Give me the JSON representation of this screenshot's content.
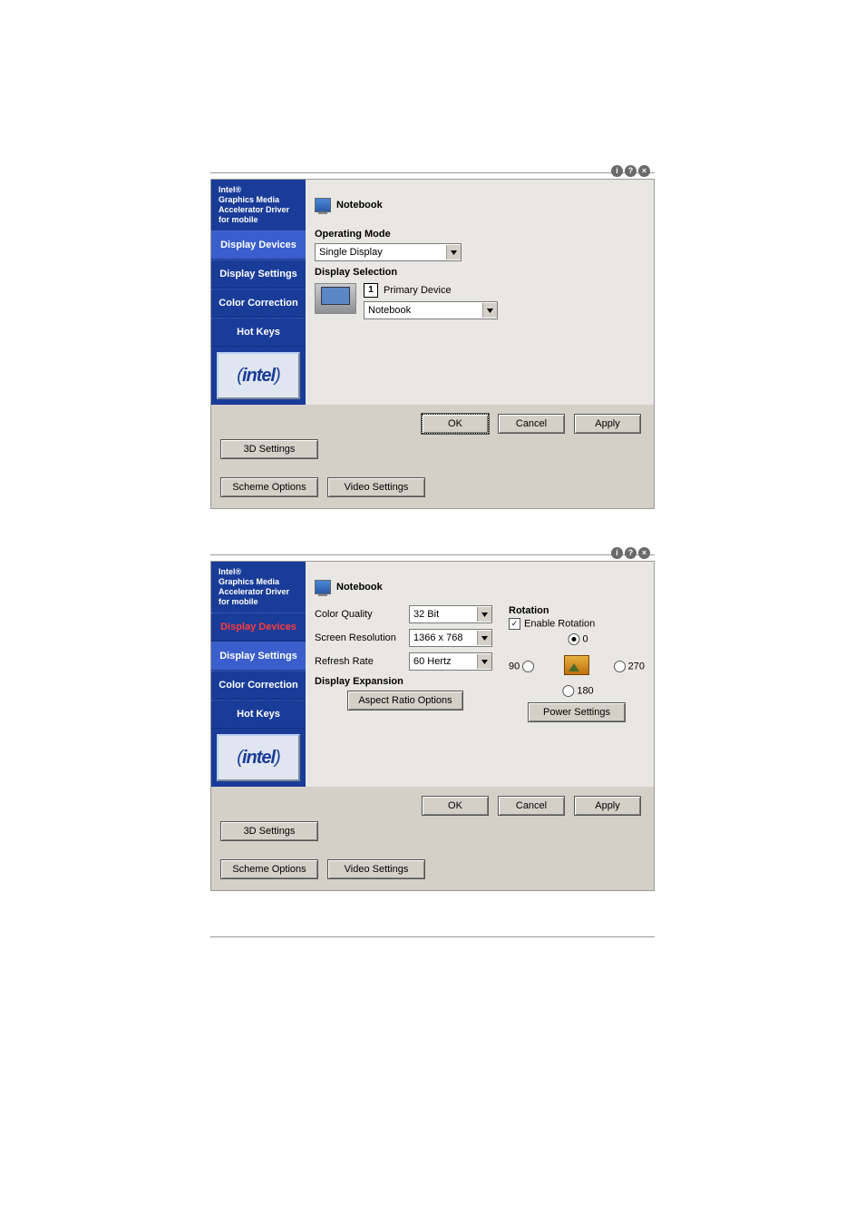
{
  "panel1": {
    "sidebar_title": "Intel®\nGraphics Media\nAccelerator Driver\nfor mobile",
    "tabs": [
      "Display Devices",
      "Display Settings",
      "Color Correction",
      "Hot Keys"
    ],
    "active_tab": 0,
    "logo": "intel",
    "header": "Notebook",
    "operating_mode_label": "Operating Mode",
    "operating_mode_value": "Single Display",
    "display_selection_label": "Display Selection",
    "primary_badge": "1",
    "primary_label": "Primary Device",
    "primary_value": "Notebook",
    "buttons": {
      "ok": "OK",
      "cancel": "Cancel",
      "apply": "Apply"
    },
    "extra_buttons": [
      "3D Settings",
      "Scheme Options",
      "Video Settings"
    ]
  },
  "panel2": {
    "sidebar_title": "Intel®\nGraphics Media\nAccelerator Driver\nfor mobile",
    "tabs": [
      "Display Devices",
      "Display Settings",
      "Color Correction",
      "Hot Keys"
    ],
    "active_tab": 1,
    "logo": "intel",
    "header": "Notebook",
    "fields": {
      "color_quality": {
        "label": "Color Quality",
        "value": "32 Bit"
      },
      "screen_resolution": {
        "label": "Screen Resolution",
        "value": "1366 x 768"
      },
      "refresh_rate": {
        "label": "Refresh Rate",
        "value": "60 Hertz"
      }
    },
    "display_expansion_label": "Display Expansion",
    "aspect_ratio_button": "Aspect Ratio Options",
    "rotation": {
      "title": "Rotation",
      "enable_label": "Enable Rotation",
      "enabled": true,
      "options": {
        "r0": "0",
        "r90": "90",
        "r180": "180",
        "r270": "270"
      },
      "selected": "0"
    },
    "power_settings_button": "Power Settings",
    "buttons": {
      "ok": "OK",
      "cancel": "Cancel",
      "apply": "Apply"
    },
    "extra_buttons": [
      "3D Settings",
      "Scheme Options",
      "Video Settings"
    ]
  },
  "titlebar_icons": [
    "info-icon",
    "help-icon",
    "close-icon"
  ]
}
